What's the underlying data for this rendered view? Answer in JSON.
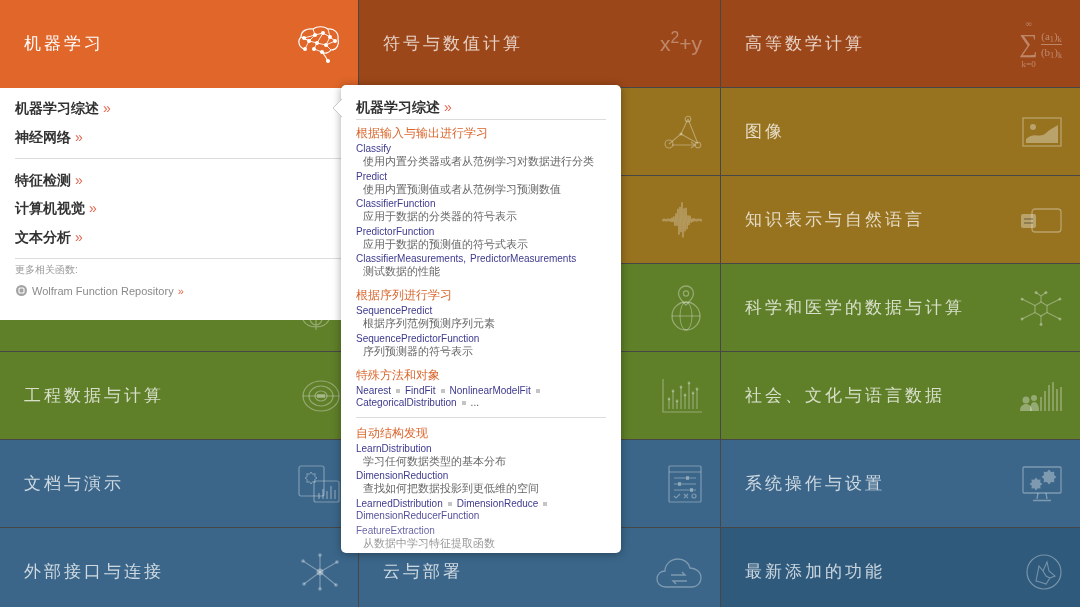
{
  "columns": [
    {
      "tiles": [
        {
          "title": "机器学习",
          "color": "#e0662a",
          "selected": true
        },
        {
          "color": "#5f7f29",
          "selected": false
        },
        {
          "title": "工程数据与计算",
          "color": "#5f7f29",
          "selected": false
        },
        {
          "title": "文档与演示",
          "color": "#3b6689",
          "selected": false
        },
        {
          "title": "外部接口与连接",
          "color": "#3b6689",
          "selected": false
        }
      ]
    },
    {
      "tiles": [
        {
          "title": "符号与数值计算",
          "glyph": "x$^{2}$+y",
          "color": "#9c4719",
          "selected": false
        },
        {
          "color": "#97721f",
          "selected": false
        },
        {
          "color": "#97721f",
          "selected": false
        },
        {
          "color": "#5f7f29",
          "selected": false
        },
        {
          "color": "#5f7f29",
          "selected": false
        },
        {
          "color": "#3b6689",
          "selected": false
        },
        {
          "title": "云与部署",
          "color": "#3b6689",
          "selected": false
        }
      ]
    },
    {
      "tiles": [
        {
          "title": "高等数学计算",
          "formula": {
            "operator": "∑",
            "upper": "∞",
            "lower": "k=0",
            "numerator": "(a$_{1}$)$_{k}$",
            "denominator": "(b$_{1}$)$_{k}$"
          },
          "color": "#9c4719",
          "selected": false
        },
        {
          "title": "图像",
          "color": "#97721f",
          "selected": false
        },
        {
          "title": "知识表示与自然语言",
          "color": "#97721f",
          "selected": false
        },
        {
          "title": "科学和医学的数据与计算",
          "color": "#5f7f29",
          "selected": false
        },
        {
          "title": "社会、文化与语言数据",
          "color": "#5f7f29",
          "selected": false
        },
        {
          "title": "系统操作与设置",
          "color": "#3b6689",
          "selected": false
        },
        {
          "title": "最新添加的功能",
          "color": "#2f5a7c",
          "selected": false
        }
      ]
    }
  ],
  "menu": {
    "groups": [
      {
        "items": [
          {
            "label": "机器学习综述",
            "arrow": "»"
          },
          {
            "label": "神经网络",
            "arrow": "»"
          }
        ]
      },
      {
        "items": [
          {
            "label": "特征检测",
            "arrow": "»"
          },
          {
            "label": "计算机视觉",
            "arrow": "»"
          },
          {
            "label": "文本分析",
            "arrow": "»"
          }
        ]
      }
    ],
    "more": {
      "caption": "更多相关函数:",
      "link": {
        "label": "Wolfram Function Repository",
        "arrow": "»"
      }
    }
  },
  "popup": {
    "title": "机器学习综述",
    "arrow": "»",
    "groups": [
      {
        "sections": [
          {
            "heading": "根据输入与输出进行学习",
            "entries": [
              {
                "kind": "function",
                "names": [
                  "Classify"
                ],
                "description": "使用内置分类器或者从范例学习对数据进行分类"
              },
              {
                "kind": "function",
                "names": [
                  "Predict"
                ],
                "description": "使用内置预测值或者从范例学习预测数值"
              },
              {
                "kind": "function",
                "names": [
                  "ClassifierFunction"
                ],
                "description": "应用于数据的分类器的符号表示"
              },
              {
                "kind": "function",
                "names": [
                  "PredictorFunction"
                ],
                "description": "应用于数据的预测值的符号式表示"
              },
              {
                "kind": "function",
                "names": [
                  "ClassifierMeasurements",
                  "PredictorMeasurements"
                ],
                "separator": ",",
                "description": "测试数据的性能"
              }
            ]
          },
          {
            "heading": "根据序列进行学习",
            "entries": [
              {
                "kind": "function",
                "names": [
                  "SequencePredict"
                ],
                "description": "根据序列范例预测序列元素"
              },
              {
                "kind": "function",
                "names": [
                  "SequencePredictorFunction"
                ],
                "description": "序列预测器的符号表示"
              }
            ]
          },
          {
            "heading": "特殊方法和对象",
            "entries": [
              {
                "kind": "list",
                "names": [
                  "Nearest",
                  "FindFit",
                  "NonlinearModelFit",
                  "CategoricalDistribution"
                ],
                "more": "..."
              }
            ]
          }
        ]
      },
      {
        "sections": [
          {
            "heading": "自动结构发现",
            "entries": [
              {
                "kind": "function",
                "names": [
                  "LearnDistribution"
                ],
                "description": "学习任何数据类型的基本分布"
              },
              {
                "kind": "function",
                "names": [
                  "DimensionReduction"
                ],
                "description": "查找如何把数据投影到更低维的空间"
              },
              {
                "kind": "list",
                "names": [
                  "LearnedDistribution",
                  "DimensionReduce",
                  "DimensionReducerFunction"
                ]
              },
              {
                "kind": "function",
                "names": [
                  "FeatureExtraction"
                ],
                "description": "从数据中学习特征提取函数"
              }
            ]
          }
        ]
      }
    ]
  }
}
